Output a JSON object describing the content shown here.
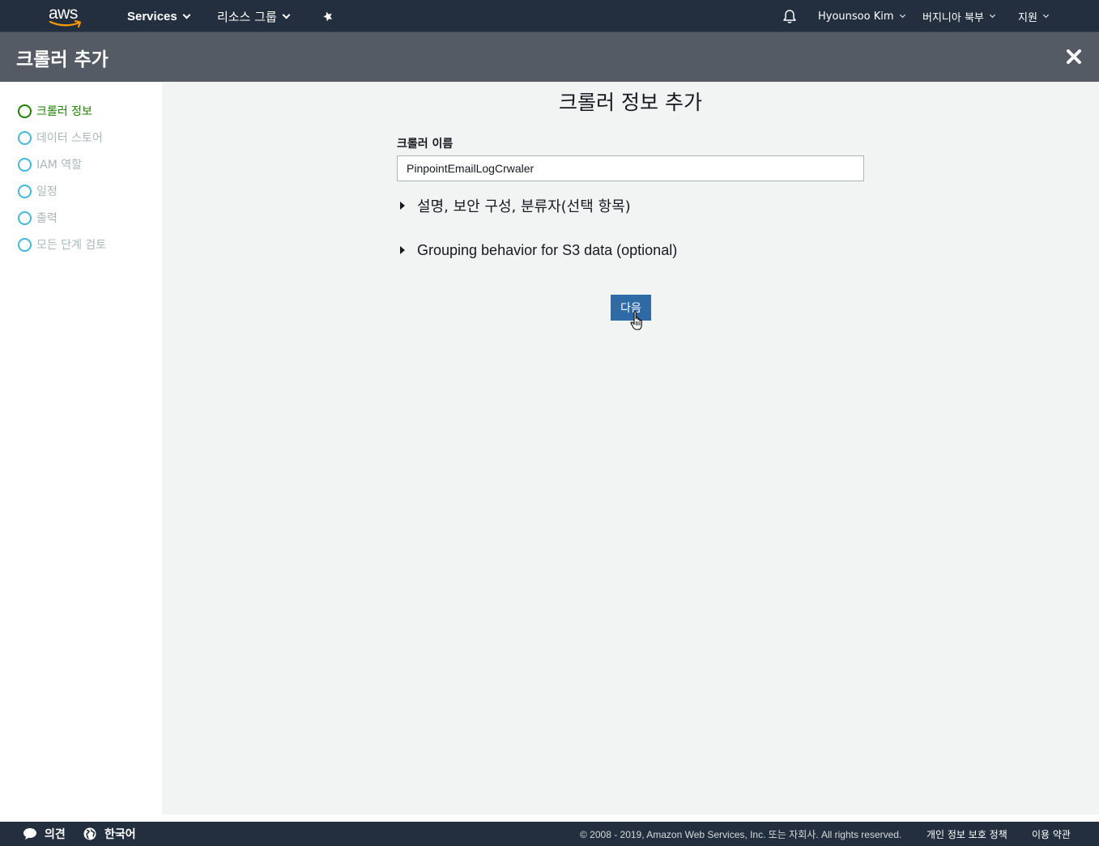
{
  "topnav": {
    "logo_text": "aws",
    "services_label": "Services",
    "resource_groups_label": "리소스 그룹",
    "pin_icon": "pin-icon",
    "bell_icon": "bell-icon",
    "user_label": "Hyounsoo Kim",
    "region_label": "버지니아 북부",
    "support_label": "지원"
  },
  "titlebar": {
    "title": "크롤러 추가",
    "close_icon": "close-icon"
  },
  "sidebar": {
    "steps": [
      {
        "label": "크롤러 정보",
        "state": "active"
      },
      {
        "label": "데이터 스토어",
        "state": "pending"
      },
      {
        "label": "IAM 역할",
        "state": "pending"
      },
      {
        "label": "일정",
        "state": "pending"
      },
      {
        "label": "출력",
        "state": "pending"
      },
      {
        "label": "모든 단계 검토",
        "state": "pending"
      }
    ]
  },
  "main": {
    "page_title": "크롤러 정보 추가",
    "crawler_name_label": "크롤러 이름",
    "crawler_name_value": "PinpointEmailLogCrwaler",
    "expander_optional": "설명, 보안 구성, 분류자(선택 항목)",
    "expander_grouping": "Grouping behavior for S3 data (optional)",
    "next_button": "다음"
  },
  "footer": {
    "feedback_label": "의견",
    "language_label": "한국어",
    "copyright": "© 2008 - 2019, Amazon Web Services, Inc. 또는 자회사. All rights reserved.",
    "privacy_label": "개인 정보 보호 정책",
    "terms_label": "이용 약관"
  },
  "colors": {
    "nav_bg": "#232f3e",
    "title_bg": "#545b64",
    "main_bg": "#f2f3f3",
    "active_step": "#1d8102",
    "pending_circle": "#44b9d6",
    "pending_text": "#aab7b8",
    "button_bg": "#2e6aa5"
  }
}
